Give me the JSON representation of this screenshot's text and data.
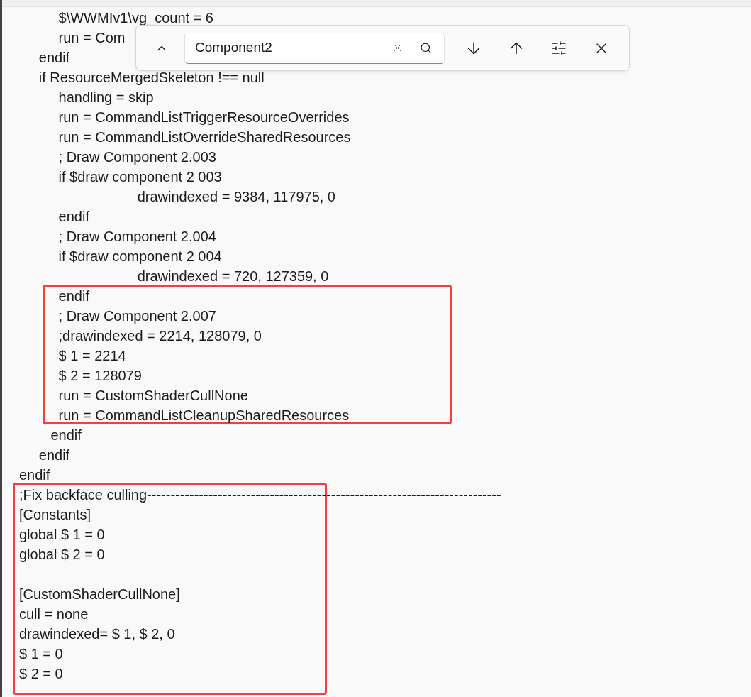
{
  "editor": {
    "blocks": [
      [
        "          $\\WWMIv1\\vg_count = 6",
        "          run = Com",
        "     endif",
        "     if ResourceMergedSkeleton !== null",
        "          handling = skip",
        "          run = CommandListTriggerResourceOverrides",
        "          run = CommandListOverrideSharedResources",
        "          ; Draw Component 2.003",
        "          if $draw component 2 003",
        "                              drawindexed = 9384, 117975, 0",
        "          endif",
        "          ; Draw Component 2.004",
        "          if $draw component 2 004",
        "                              drawindexed = 720, 127359, 0",
        "          endif",
        "          ; Draw Component 2.007",
        "          ;drawindexed = 2214, 128079, 0",
        "          $ 1 = 2214",
        "          $ 2 = 128079",
        "          run = CustomShaderCullNone",
        "          run = CommandListCleanupSharedResources",
        "        endif",
        "     endif",
        "endif",
        ";Fix backface culling---------------------------------------------------------------------------",
        "[Constants]",
        "global $ 1 = 0",
        "global $ 2 = 0"
      ],
      [
        "[CustomShaderCullNone]",
        "cull = none",
        "drawindexed= $ 1, $ 2, 0",
        "$ 1 = 0",
        "$ 2 = 0"
      ]
    ]
  },
  "find_bar": {
    "query": "Component2"
  }
}
